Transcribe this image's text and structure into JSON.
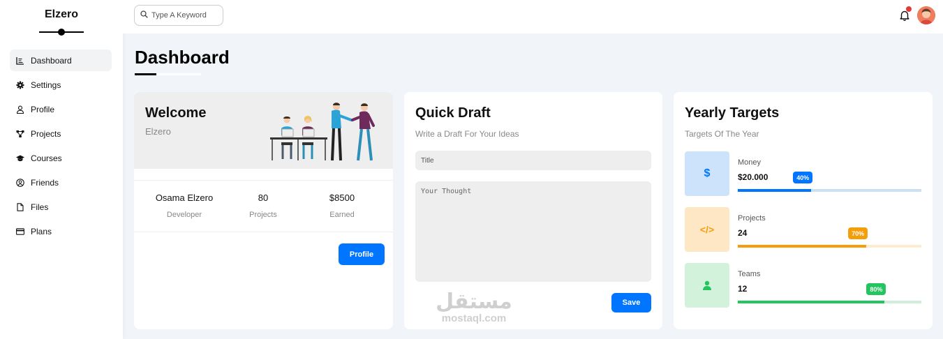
{
  "sidebar": {
    "brand": "Elzero",
    "items": [
      {
        "label": "Dashboard",
        "icon": "chart-icon"
      },
      {
        "label": "Settings",
        "icon": "gear-icon"
      },
      {
        "label": "Profile",
        "icon": "user-icon"
      },
      {
        "label": "Projects",
        "icon": "diagram-icon"
      },
      {
        "label": "Courses",
        "icon": "graduation-cap-icon"
      },
      {
        "label": "Friends",
        "icon": "user-circle-icon"
      },
      {
        "label": "Files",
        "icon": "file-icon"
      },
      {
        "label": "Plans",
        "icon": "credit-card-icon"
      }
    ]
  },
  "header": {
    "search_placeholder": "Type A Keyword",
    "notification_color": "#e53935"
  },
  "page": {
    "title": "Dashboard"
  },
  "welcome": {
    "title": "Welcome",
    "subtitle": "Elzero",
    "stats": [
      {
        "value": "Osama Elzero",
        "label": "Developer"
      },
      {
        "value": "80",
        "label": "Projects"
      },
      {
        "value": "$8500",
        "label": "Earned"
      }
    ],
    "button": "Profile"
  },
  "draft": {
    "title": "Quick Draft",
    "subtitle": "Write a Draft For Your Ideas",
    "title_placeholder": "Title",
    "body_placeholder": "Your Thought",
    "button": "Save",
    "watermark_logo": "مستقل",
    "watermark_url": "mostaql.com"
  },
  "targets": {
    "title": "Yearly Targets",
    "subtitle": "Targets Of The Year",
    "items": [
      {
        "label": "Money",
        "value": "$20.000",
        "percent": 40,
        "badge": "40%",
        "icon": "$",
        "color": "#0075ff",
        "track": "#c9e0f5",
        "bg": "#cde3fb"
      },
      {
        "label": "Projects",
        "value": "24",
        "percent": 70,
        "badge": "70%",
        "icon": "</>",
        "color": "#f59e0b",
        "track": "#fdeccf",
        "bg": "#fde7c5"
      },
      {
        "label": "Teams",
        "value": "12",
        "percent": 80,
        "badge": "80%",
        "icon": "person",
        "color": "#22c55e",
        "track": "#cfeed9",
        "bg": "#d2f2dc"
      }
    ]
  },
  "accent": "#0075ff"
}
